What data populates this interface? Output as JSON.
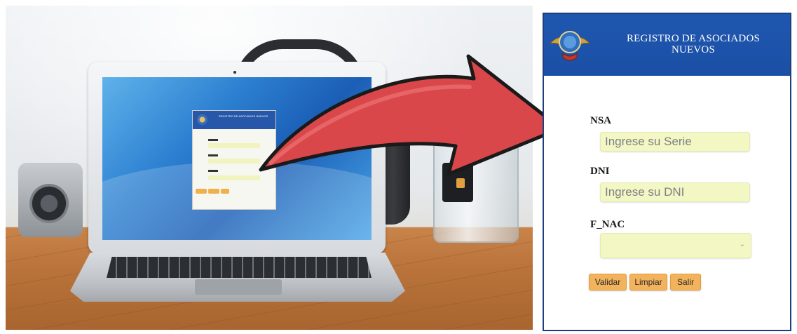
{
  "panel": {
    "title": "REGISTRO DE ASOCIADOS NUEVOS",
    "fields": {
      "nsa": {
        "label": "NSA",
        "placeholder": "Ingrese su Serie"
      },
      "dni": {
        "label": "DNI",
        "placeholder": "Ingrese su DNI"
      },
      "f_nac": {
        "label": "F_NAC",
        "value": ""
      }
    },
    "buttons": {
      "validar": "Validar",
      "limpiar": "Limpiar",
      "salir": "Salir"
    }
  },
  "colors": {
    "header_blue": "#1f57b0",
    "input_fill": "#f3f7c4",
    "button_orange": "#f3b35c",
    "arrow_red": "#d9474a"
  },
  "icons": {
    "emblem": "association-emblem-icon",
    "select_chevron": "chevron-down-icon",
    "arrow": "curved-arrow"
  }
}
